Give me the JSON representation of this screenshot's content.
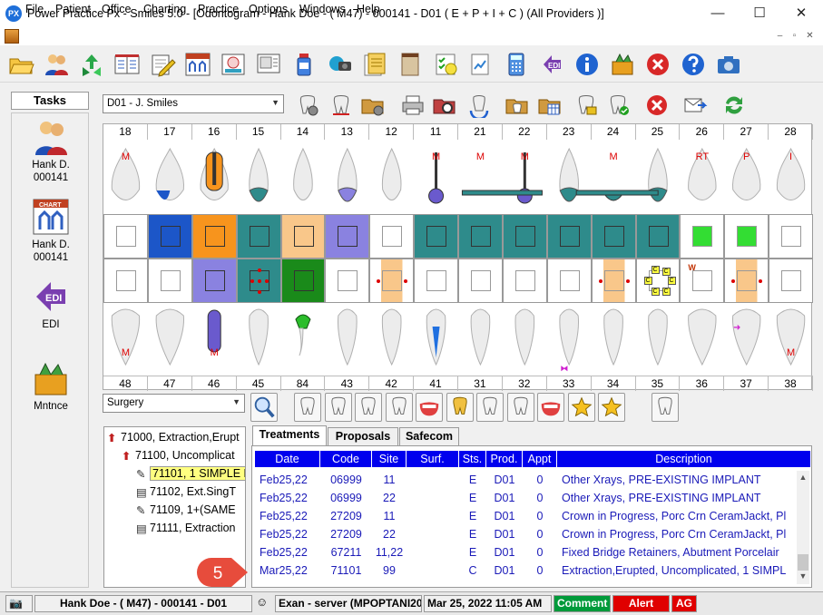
{
  "window": {
    "title": "Power Practice Px - Smiles 5.0 - [Odontogram - Hank Doe - ( M47) - 000141 - D01  ( E + P + I + C )  (All Providers )]",
    "logo_text": "PX",
    "minimize": "—",
    "maximize": "☐",
    "close": "✕"
  },
  "menu": [
    "File",
    "Patient",
    "Office",
    "Charting",
    "Practice",
    "Options",
    "Windows",
    "Help"
  ],
  "mdi_controls": [
    "–",
    "▫",
    "✕"
  ],
  "tasks": {
    "header": "Tasks",
    "items": [
      {
        "line1": "Hank D.",
        "line2": "000141"
      },
      {
        "line1": "Hank D.",
        "line2": "000141"
      },
      {
        "line1": "EDI",
        "line2": ""
      },
      {
        "line1": "Mntnce",
        "line2": ""
      }
    ],
    "edi_icon_text": "EDI",
    "chart_icon_text": "CHART"
  },
  "provider_select": {
    "value": "D01 - J. Smiles"
  },
  "odontogram": {
    "upper_numbers": [
      "18",
      "17",
      "16",
      "15",
      "14",
      "13",
      "12",
      "11",
      "21",
      "22",
      "23",
      "24",
      "25",
      "26",
      "27",
      "28"
    ],
    "lower_numbers": [
      "48",
      "47",
      "46",
      "45",
      "84",
      "43",
      "42",
      "41",
      "31",
      "32",
      "33",
      "34",
      "35",
      "36",
      "37",
      "38"
    ],
    "upper_marks": [
      {
        "tooth": "18",
        "text": "M"
      },
      {
        "tooth": "11",
        "text": "M"
      },
      {
        "tooth": "21",
        "text": "M"
      },
      {
        "tooth": "22",
        "text": "M"
      },
      {
        "tooth": "24",
        "text": "M"
      },
      {
        "tooth": "26",
        "text": "RT"
      },
      {
        "tooth": "27",
        "text": "P"
      },
      {
        "tooth": "28",
        "text": "I"
      }
    ],
    "lower_marks": [
      {
        "tooth": "48",
        "text": "M"
      },
      {
        "tooth": "46",
        "text": "M"
      },
      {
        "tooth": "38",
        "text": "M"
      }
    ],
    "caries_letter": "C",
    "w_letter": "W",
    "colors": {
      "blue": "#1c56c8",
      "orange": "#f7941d",
      "teal": "#2e8b8b",
      "peach": "#f9c78a",
      "lavender": "#8a82e0",
      "green": "#1a8a1a",
      "bright_green": "#33dd33",
      "purple_post": "#6a5acd"
    }
  },
  "procedure_select": {
    "value": "Surgery"
  },
  "tree": {
    "nodes": [
      {
        "code": "71000, Extraction,Erupt"
      },
      {
        "code": "71100, Uncomplicat"
      },
      {
        "code": "71101, 1 SIMPLE EXO"
      },
      {
        "code": "71102, Ext.SingT"
      },
      {
        "code": "71109, 1+(SAME"
      },
      {
        "code": "71111, Extraction"
      }
    ]
  },
  "tabs": [
    "Treatments",
    "Proposals",
    "Safecom"
  ],
  "grid": {
    "columns": [
      "Date",
      "Code",
      "Site",
      "Surf.",
      "Sts.",
      "Prod.",
      "Appt",
      "Description"
    ],
    "rows": [
      {
        "date": "Feb25,22",
        "code": "06999",
        "site": "11",
        "surf": "",
        "sts": "E",
        "prod": "D01",
        "appt": "0",
        "desc": "Other Xrays, PRE-EXISTING IMPLANT"
      },
      {
        "date": "Feb25,22",
        "code": "06999",
        "site": "22",
        "surf": "",
        "sts": "E",
        "prod": "D01",
        "appt": "0",
        "desc": "Other Xrays, PRE-EXISTING IMPLANT"
      },
      {
        "date": "Feb25,22",
        "code": "27209",
        "site": "11",
        "surf": "",
        "sts": "E",
        "prod": "D01",
        "appt": "0",
        "desc": "Crown in Progress, Porc Crn CeramJackt, Pl"
      },
      {
        "date": "Feb25,22",
        "code": "27209",
        "site": "22",
        "surf": "",
        "sts": "E",
        "prod": "D01",
        "appt": "0",
        "desc": "Crown in Progress, Porc Crn CeramJackt, Pl"
      },
      {
        "date": "Feb25,22",
        "code": "67211",
        "site": "11,22",
        "surf": "",
        "sts": "E",
        "prod": "D01",
        "appt": "0",
        "desc": "Fixed Bridge Retainers, Abutment Porcelair"
      },
      {
        "date": "Mar25,22",
        "code": "71101",
        "site": "99",
        "surf": "",
        "sts": "C",
        "prod": "D01",
        "appt": "0",
        "desc": "Extraction,Erupted, Uncomplicated, 1 SIMPL"
      }
    ]
  },
  "callout": {
    "number": "5"
  },
  "status": {
    "patient": "Hank Doe - ( M47) - 000141 - D01",
    "server": "Exan - server (MPOPTANI20",
    "datetime": "Mar 25, 2022 11:05 AM",
    "comment": "Comment",
    "alert": "Alert",
    "ag": "AG"
  }
}
